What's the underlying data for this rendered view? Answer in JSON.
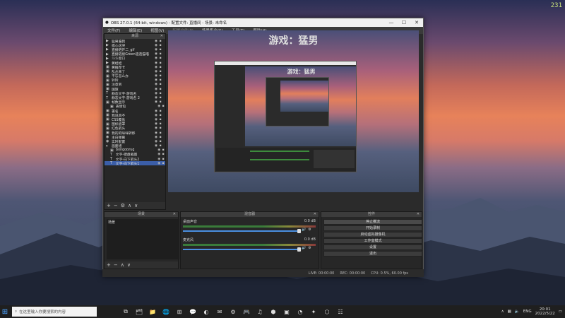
{
  "corner_badge": "231",
  "window": {
    "title": "OBS 27.0.1 (64-bit, windows) - 配置文件: 直播间 - 场景: 未命名",
    "controls": [
      "—",
      "☐",
      "✕"
    ]
  },
  "menu": [
    {
      "label": "文件(F)",
      "enabled": true
    },
    {
      "label": "编辑(E)",
      "enabled": true
    },
    {
      "label": "视图(V)",
      "enabled": true
    },
    {
      "label": "配置文件(P)",
      "enabled": false
    },
    {
      "label": "场景集合(S)",
      "enabled": true
    },
    {
      "label": "工具(T)",
      "enabled": true
    },
    {
      "label": "帮助(H)",
      "enabled": true
    }
  ],
  "sources": {
    "header": "来源",
    "items": [
      {
        "icon": "▶",
        "name": "猛男骗我"
      },
      {
        "icon": "▶",
        "name": "孤心这哭"
      },
      {
        "icon": "▶",
        "name": "直播链开二_gif"
      },
      {
        "icon": "▶",
        "name": "直播链接Green遗造猫喵"
      },
      {
        "icon": "▶",
        "name": "斗斗窗口"
      },
      {
        "icon": "▶",
        "name": "黄蛙蛙"
      },
      {
        "icon": "▣",
        "name": "黄推荐卡"
      },
      {
        "icon": "▣",
        "name": "乱丛来了"
      },
      {
        "icon": "▣",
        "name": "不忘怎么办"
      },
      {
        "icon": "▣",
        "name": "铃铃"
      },
      {
        "icon": "▣",
        "name": "注意到"
      },
      {
        "icon": "▣",
        "name": "国旗"
      },
      {
        "icon": "T",
        "name": "静态文字-游戏名"
      },
      {
        "icon": "T",
        "name": "静态文字-游戏名 2"
      },
      {
        "icon": "▣",
        "name": "帧数显示"
      },
      {
        "icon": "▣",
        "name": "表情包",
        "indent": true
      },
      {
        "icon": "▣",
        "name": "署名"
      },
      {
        "icon": "▣",
        "name": "我说真不"
      },
      {
        "icon": "▣",
        "name": "CSS覆盖"
      },
      {
        "icon": "▣",
        "name": "图标遮罩"
      },
      {
        "icon": "▣",
        "name": "红色箭头"
      },
      {
        "icon": "▣",
        "name": "我的的咪咪转移"
      },
      {
        "icon": "◉",
        "name": "主白弹幕"
      },
      {
        "icon": "◉",
        "name": "实时配置"
      },
      {
        "icon": "▾",
        "name": "画面组",
        "folder": true
      },
      {
        "icon": "▣",
        "name": "BongoBrug",
        "indent": true
      },
      {
        "icon": "T",
        "name": "文字-键盘截图",
        "indent": true
      },
      {
        "icon": "T",
        "name": "文字-向下箭头2",
        "indent": true
      },
      {
        "icon": "T",
        "name": "文字-向下箭头1",
        "indent": true,
        "selected": true
      }
    ]
  },
  "preview": {
    "title": "游戏：猛男"
  },
  "scenes": {
    "header": "场景",
    "items": [
      "场景"
    ]
  },
  "mixer": {
    "header": "混音器",
    "channels": [
      {
        "name": "桌面声音",
        "db": "0.0 dB"
      },
      {
        "name": "麦克风",
        "db": "0.0 dB"
      }
    ]
  },
  "controls": {
    "header": "控件",
    "buttons": [
      "停止推流",
      "开始录制",
      "启动虚拟摄像机",
      "工作室模式",
      "设置",
      "退出"
    ]
  },
  "status": {
    "drop": "LIVE: 00:00:00",
    "rec": "REC: 00:00:00",
    "cpu": "CPU: 0.5%, 60.00 fps"
  },
  "taskbar": {
    "search_placeholder": "在这里输入你要搜索的内容",
    "apps": [
      "⧉",
      "🗂",
      "📁",
      "🌐",
      "⊞",
      "💬",
      "◐",
      "✉",
      "⚙",
      "🎮",
      "♫",
      "⬢",
      "▣",
      "◔",
      "✦",
      "⬡",
      "☷"
    ],
    "tray_lang": "ENG",
    "time": "20:01",
    "date": "2022/5/22"
  }
}
